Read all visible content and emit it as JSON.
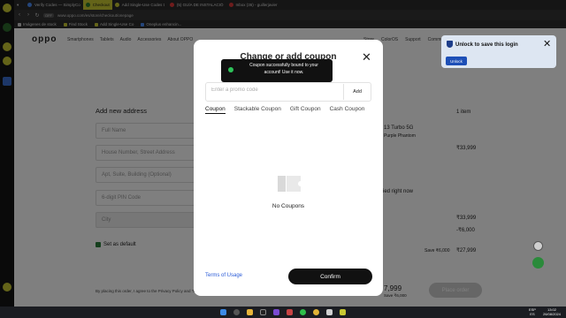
{
  "browser": {
    "tabs": [
      {
        "label": "Verify Codes — SimplyCo",
        "color": "#4b8df7"
      },
      {
        "label": "Checkout",
        "color": "#2c7a2c",
        "active": true
      },
      {
        "label": "Add Single-Use Codes t",
        "color": "#c8c832"
      },
      {
        "label": "(5) GUÍA DE INSTALACIÓ",
        "color": "#e03838"
      },
      {
        "label": "Inbox (36) - guillerjavier",
        "color": "#d93a3a"
      }
    ],
    "url": "www.oppo.com/es/store/checkout/onepage",
    "url_badge": "OFF",
    "bookmarks": [
      "Imágenes de stock",
      "Find Stock",
      "Add Single-Use Co",
      "Oneplus enhancin..."
    ]
  },
  "site": {
    "logo": "oppo",
    "nav": [
      "Smartphones",
      "Tablets",
      "Audio",
      "Accessories",
      "About OPPO"
    ],
    "nav_right": [
      "Store",
      "ColorOS",
      "Support",
      "Community"
    ]
  },
  "address_form": {
    "title": "Add new address",
    "fields": [
      "Full Name",
      "House Number, Street Address",
      "Apt, Suite, Building (Optional)",
      "6-digit PIN Code",
      "City"
    ],
    "set_default": "Set as default"
  },
  "order_summary": {
    "items_count": "1 item",
    "product": "13 Turbo 5G",
    "color": "Purple Phantom",
    "price": "₹33,999",
    "note": "ied right now",
    "subtotal": "₹33,999",
    "discount": "-₹6,000",
    "total_label": "Save ₹6,000",
    "total": "₹27,999",
    "footer_price": "7,999",
    "footer_save": "Save ₹6,000",
    "place_order": "Place order"
  },
  "placing_text": "By placing this order, I agree to the Privacy Policy and Terms of Use",
  "modal": {
    "title": "Change or add coupon",
    "promo_placeholder": "Enter a promo code",
    "add_label": "Add",
    "tabs": [
      "Coupon",
      "Stackable Coupon",
      "Gift Coupon",
      "Cash Coupon"
    ],
    "empty_text": "No Coupons",
    "terms_label": "Terms of Usage",
    "confirm_label": "Confirm"
  },
  "toast": {
    "message": "Coupon successfully bound to your account! Use it now."
  },
  "password_popup": {
    "title": "Unlock to save this login",
    "button": "Unlock"
  },
  "taskbar": {
    "icons": [
      "start-icon",
      "search-icon",
      "files-icon",
      "app-icon",
      "app-icon",
      "media-icon",
      "whatsapp-icon",
      "chrome-icon",
      "app-icon",
      "app-icon"
    ],
    "lang": "ESP",
    "lang_sub": "ES",
    "time": "13:02",
    "date": "26/08/2024"
  }
}
